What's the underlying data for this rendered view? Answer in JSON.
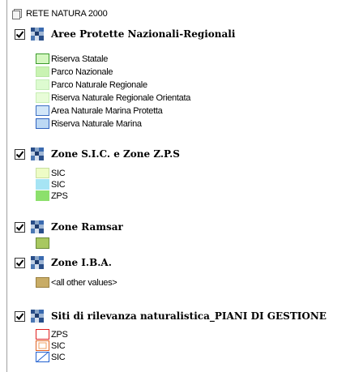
{
  "root": {
    "label": "RETE NATURA 2000",
    "icon": "map-layer-stack-icon"
  },
  "groups": [
    {
      "label": "Aree Protette Nazionali-Regionali",
      "checked": true,
      "items": [
        {
          "label": "Riserva Statale",
          "fill": "#d4f7c0",
          "stroke": "#3a9a2a"
        },
        {
          "label": "Parco Nazionale",
          "fill": "#c9f3b2",
          "stroke": "#b8e6a4"
        },
        {
          "label": "Parco Naturale Regionale",
          "fill": "#ddfbd0",
          "stroke": "#c4ecb6"
        },
        {
          "label": "Riserva Naturale Regionale Orientata",
          "fill": "#e8fcd8",
          "stroke": "#c8eeb4"
        },
        {
          "label": "Area Naturale Marina Protetta",
          "fill": "#d2e6f8",
          "stroke": "#3b6fc4"
        },
        {
          "label": "Riserva Naturale Marina",
          "fill": "#bcd8f4",
          "stroke": "#2f62c0"
        }
      ]
    },
    {
      "label": "Zone S.I.C. e Zone Z.P.S",
      "checked": true,
      "items": [
        {
          "label": "SIC",
          "fill": "#eefcc6",
          "stroke": "#c8e0a0"
        },
        {
          "label": "SIC",
          "fill": "#a6e4f4",
          "stroke": "#a6e4f4"
        },
        {
          "label": "ZPS",
          "fill": "#8ce06c",
          "stroke": "#8ce06c"
        }
      ]
    },
    {
      "label": "Zone Ramsar",
      "checked": true,
      "items": [
        {
          "label": "",
          "fill": "#a8c860",
          "stroke": "#6a8a3a"
        }
      ]
    },
    {
      "label": "Zone I.B.A.",
      "checked": true,
      "items": [
        {
          "label": "<all other values>",
          "fill": "#c8ac66",
          "stroke": "#9a8040"
        }
      ]
    },
    {
      "label": "Siti di rilevanza naturalistica_PIANI DI GESTIONE",
      "checked": true,
      "items": [
        {
          "label": "ZPS",
          "fill": "#ffffff",
          "stroke": "#e02020",
          "style": "outline"
        },
        {
          "label": "SIC",
          "fill": "#ffffff",
          "stroke": "#e06020",
          "style": "outline-cross"
        },
        {
          "label": "SIC",
          "fill": "#ffffff",
          "stroke": "#2060d0",
          "style": "outline-hatch"
        }
      ]
    }
  ]
}
